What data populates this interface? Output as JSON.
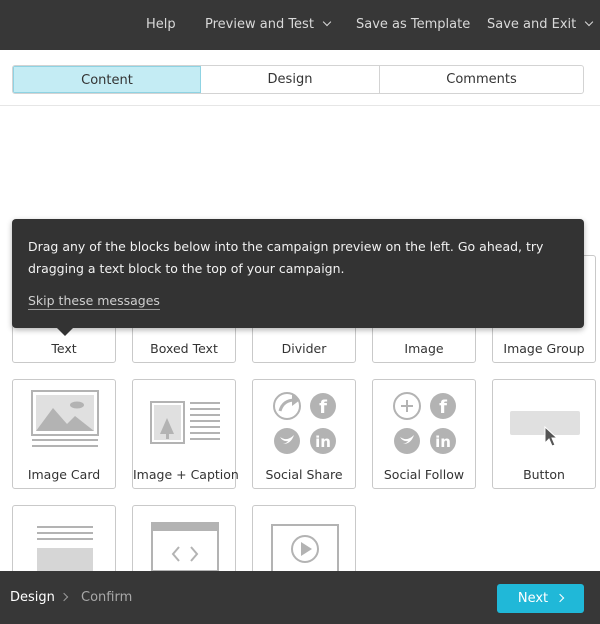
{
  "topbar": {
    "help": "Help",
    "preview_and_test": "Preview and Test",
    "save_as_template": "Save as Template",
    "save_and_exit": "Save and Exit"
  },
  "tabs": [
    {
      "label": "Content",
      "active": true
    },
    {
      "label": "Design",
      "active": false
    },
    {
      "label": "Comments",
      "active": false
    }
  ],
  "tooltip": {
    "message": "Drag any of the blocks below into the campaign preview on the left. Go ahead, try dragging a text block to the top of your campaign.",
    "skip_link": "Skip these messages"
  },
  "blocks": [
    {
      "label": "Text",
      "icon": "text-lines-icon"
    },
    {
      "label": "Boxed Text",
      "icon": "boxed-text-icon"
    },
    {
      "label": "Divider",
      "icon": "divider-icon"
    },
    {
      "label": "Image",
      "icon": "image-icon"
    },
    {
      "label": "Image Group",
      "icon": "image-group-icon"
    },
    {
      "label": "Image Card",
      "icon": "image-card-icon"
    },
    {
      "label": "Image + Caption",
      "icon": "image-caption-icon"
    },
    {
      "label": "Social Share",
      "icon": "social-share-icon"
    },
    {
      "label": "Social Follow",
      "icon": "social-follow-icon"
    },
    {
      "label": "Button",
      "icon": "button-icon"
    },
    {
      "label": "",
      "icon": "footer-block-icon"
    },
    {
      "label": "",
      "icon": "code-block-icon"
    },
    {
      "label": "",
      "icon": "video-block-icon"
    }
  ],
  "footer": {
    "steps": [
      "Design",
      "Confirm"
    ],
    "current_step": "Design",
    "next_label": "Next"
  },
  "colors": {
    "bar": "#373737",
    "accent": "#20b8d8",
    "active_tab": "#c4ecf4",
    "icon_gray": "#b3b3b3"
  }
}
